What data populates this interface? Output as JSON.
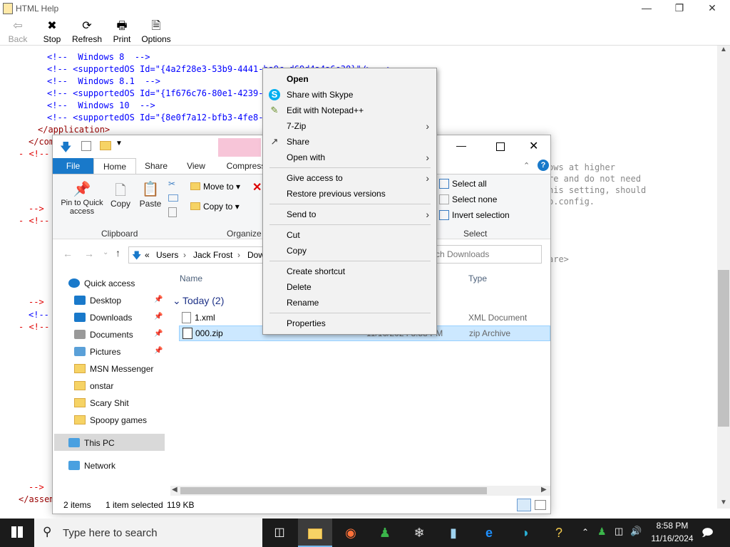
{
  "hh": {
    "title": "HTML Help",
    "toolbar": [
      {
        "label": "Back",
        "icon": "back-arrow-icon",
        "glyph": "⇦"
      },
      {
        "label": "Stop",
        "icon": "stop-icon",
        "glyph": "✖"
      },
      {
        "label": "Refresh",
        "icon": "refresh-icon",
        "glyph": "⟳"
      },
      {
        "label": "Print",
        "icon": "print-icon",
        "glyph": "🖶"
      },
      {
        "label": "Options",
        "icon": "options-icon",
        "glyph": "🗎"
      }
    ],
    "lines": [
      {
        "t": "<!--  Windows 8  -->"
      },
      {
        "t": "<!-- <supportedOS Id=\"{4a2f28e3-53b9-4441-ba9c-d69d4a4a6e38}\"/> -->"
      },
      {
        "t": "<!--  Windows 8.1  -->"
      },
      {
        "t": "<!-- <supportedOS Id=\"{1f676c76-80e1-4239-95bb-83d0f6d0da78}\"/> -->"
      },
      {
        "t": "<!--  Windows 10  -->"
      },
      {
        "t": "<!-- <supportedOS Id=\"{8e0f7a12-bfb3-4fe8-b9a5-48fd50a15a9a}\"/> -->"
      },
      {
        "t": "</application>"
      },
      {
        "t": "</compatibility>"
      },
      {
        "t": "- <!--"
      },
      {
        "t": "-->"
      },
      {
        "t": "- <!--"
      },
      {
        "t": "-->"
      },
      {
        "t": "<!--"
      },
      {
        "t": "- <!--"
      },
      {
        "t": "-->"
      },
      {
        "t": "</assembly>"
      }
    ],
    "right_text": [
      "ows at higher",
      "re and do not need",
      "his setting, should",
      "p.config.",
      "are>"
    ]
  },
  "explorer": {
    "tabs": [
      "File",
      "Home",
      "Share",
      "View",
      "Compress"
    ],
    "ribbon": {
      "pin": "Pin to Quick access",
      "copy": "Copy",
      "paste": "Paste",
      "move_to": "Move to",
      "copy_to": "Copy to",
      "select_all": "Select all",
      "select_none": "Select none",
      "invert": "Invert selection",
      "groups": [
        "Clipboard",
        "Organize",
        "Select"
      ]
    },
    "address": {
      "parts": [
        "Users",
        "Jack Frost",
        "Dow"
      ],
      "prefix": "«"
    },
    "search_placeholder": "rch Downloads",
    "nav": [
      {
        "label": "Quick access",
        "icon": "star-icon",
        "pinned": false
      },
      {
        "label": "Desktop",
        "icon": "desktop-icon",
        "pinned": true
      },
      {
        "label": "Downloads",
        "icon": "downloads-icon",
        "pinned": true
      },
      {
        "label": "Documents",
        "icon": "documents-icon",
        "pinned": true
      },
      {
        "label": "Pictures",
        "icon": "pictures-icon",
        "pinned": true
      },
      {
        "label": "MSN Messenger",
        "icon": "folder-icon",
        "pinned": false
      },
      {
        "label": "onstar",
        "icon": "folder-icon",
        "pinned": false
      },
      {
        "label": "Scary Shit",
        "icon": "folder-icon",
        "pinned": false
      },
      {
        "label": "Spoopy games",
        "icon": "folder-icon",
        "pinned": false
      },
      {
        "label": "This PC",
        "icon": "this-pc-icon",
        "pinned": false
      },
      {
        "label": "Network",
        "icon": "network-icon",
        "pinned": false
      }
    ],
    "columns": {
      "name": "Name",
      "type": "Type"
    },
    "group": "Today (2)",
    "files": [
      {
        "name": "1.xml",
        "date": "",
        "type": "XML Document"
      },
      {
        "name": "000.zip",
        "date": "11/16/2024 8:58 PM",
        "type": "zip Archive"
      }
    ],
    "status": {
      "items": "2 items",
      "selected": "1 item selected",
      "size": "119 KB"
    }
  },
  "context_menu": [
    {
      "label": "Open",
      "bold": true,
      "icon": "",
      "submenu": false
    },
    {
      "label": "Share with Skype",
      "icon": "skype-icon",
      "submenu": false
    },
    {
      "label": "Edit with Notepad++",
      "icon": "notepadpp-icon",
      "submenu": false
    },
    {
      "label": "7-Zip",
      "icon": "",
      "submenu": true
    },
    {
      "label": "Share",
      "icon": "share-icon",
      "submenu": false
    },
    {
      "label": "Open with",
      "icon": "",
      "submenu": true
    },
    {
      "sep": true
    },
    {
      "label": "Give access to",
      "icon": "",
      "submenu": true
    },
    {
      "label": "Restore previous versions",
      "icon": "",
      "submenu": false
    },
    {
      "sep": true
    },
    {
      "label": "Send to",
      "icon": "",
      "submenu": true
    },
    {
      "sep": true
    },
    {
      "label": "Cut",
      "icon": "",
      "submenu": false
    },
    {
      "label": "Copy",
      "icon": "",
      "submenu": false
    },
    {
      "sep": true
    },
    {
      "label": "Create shortcut",
      "icon": "",
      "submenu": false
    },
    {
      "label": "Delete",
      "icon": "",
      "submenu": false
    },
    {
      "label": "Rename",
      "icon": "",
      "submenu": false
    },
    {
      "sep": true
    },
    {
      "label": "Properties",
      "icon": "",
      "submenu": false
    }
  ],
  "taskbar": {
    "search_placeholder": "Type here to search",
    "time": "8:58 PM",
    "date": "11/16/2024"
  }
}
